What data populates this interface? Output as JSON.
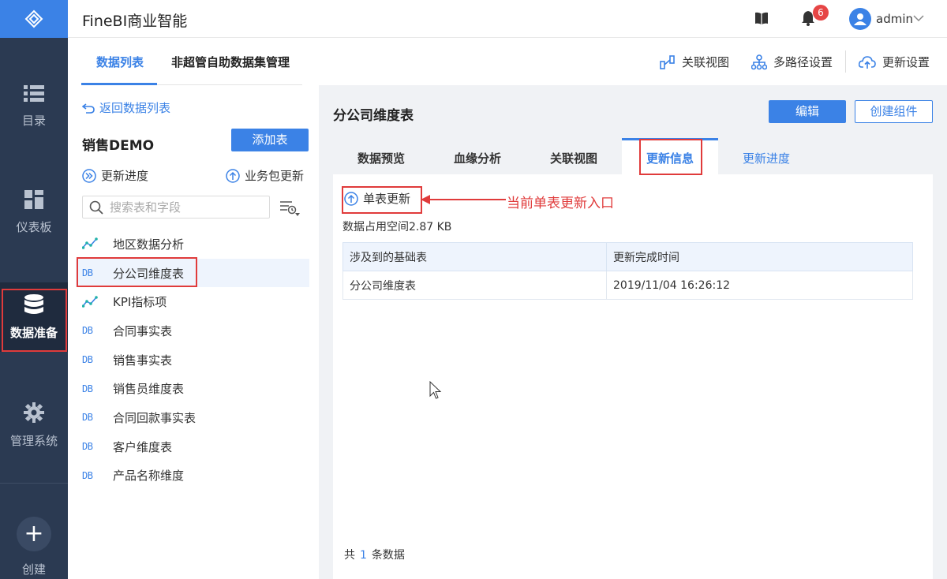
{
  "app": {
    "title": "FineBI商业智能"
  },
  "nav": {
    "items": [
      {
        "label": "目录",
        "icon": "list-icon"
      },
      {
        "label": "仪表板",
        "icon": "dashboard-icon"
      },
      {
        "label": "数据准备",
        "icon": "database-icon"
      },
      {
        "label": "管理系统",
        "icon": "gear-icon"
      }
    ],
    "create_label": "创建"
  },
  "header": {
    "notification_count": "6",
    "user": "admin"
  },
  "subnav": {
    "tabs": [
      "数据列表",
      "非超管自助数据集管理"
    ],
    "actions": [
      "关联视图",
      "多路径设置",
      "更新设置"
    ]
  },
  "left": {
    "back": "返回数据列表",
    "package_title": "销售DEMO",
    "add_table": "添加表",
    "update_progress": "更新进度",
    "package_update": "业务包更新",
    "search_placeholder": "搜索表和字段",
    "tables": [
      {
        "name": "地区数据分析",
        "type": "self"
      },
      {
        "name": "分公司维度表",
        "type": "DB"
      },
      {
        "name": "KPI指标项",
        "type": "self"
      },
      {
        "name": "合同事实表",
        "type": "DB"
      },
      {
        "name": "销售事实表",
        "type": "DB"
      },
      {
        "name": "销售员维度表",
        "type": "DB"
      },
      {
        "name": "合同回款事实表",
        "type": "DB"
      },
      {
        "name": "客户维度表",
        "type": "DB"
      },
      {
        "name": "产品名称维度",
        "type": "DB"
      }
    ]
  },
  "right": {
    "title": "分公司维度表",
    "edit": "编辑",
    "create_component": "创建组件",
    "tabs": [
      "数据预览",
      "血缘分析",
      "关联视图",
      "更新信息",
      "更新进度"
    ],
    "single_update": "单表更新",
    "space_info": "数据占用空间2.87 KB",
    "table_headers": [
      "涉及到的基础表",
      "更新完成时间"
    ],
    "rows": [
      [
        "分公司维度表",
        "2019/11/04 16:26:12"
      ]
    ],
    "count_prefix": "共",
    "count": "1",
    "count_suffix": "条数据"
  },
  "annotation": {
    "text": "当前单表更新入口"
  }
}
